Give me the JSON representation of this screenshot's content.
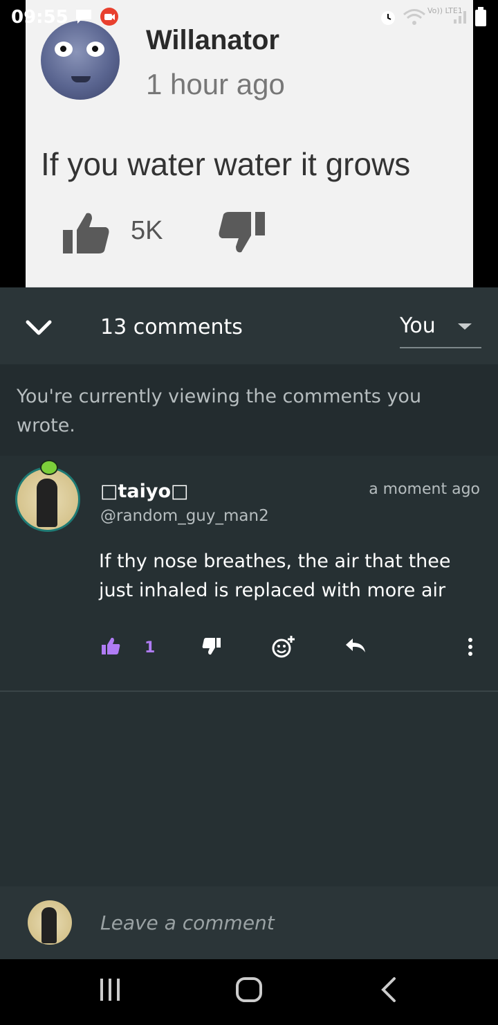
{
  "status_bar": {
    "time": "09:55",
    "icons": [
      "message-icon",
      "screen-recorder-icon",
      "alarm-icon",
      "wifi-icon",
      "volte-icon",
      "signal-icon",
      "battery-icon"
    ],
    "network_label": "Vo)) LTE1"
  },
  "meme": {
    "author": "Willanator",
    "time": "1 hour ago",
    "text": "If you water water it grows",
    "likes": "5K"
  },
  "comments_header": {
    "count_label": "13 comments",
    "filter_value": "You",
    "notice": "You're currently viewing the comments you wrote."
  },
  "comment": {
    "username": "□taiyo□",
    "handle": "@random_guy_man2",
    "time": "a moment ago",
    "body": "If thy nose breathes, the air that thee just inhaled is replaced with more air",
    "like_count": "1"
  },
  "compose": {
    "placeholder": "Leave a comment"
  },
  "colors": {
    "background": "#263033",
    "header": "#2b3538",
    "accent_like": "#b07cf5",
    "muted_text": "#b6bdbf"
  }
}
